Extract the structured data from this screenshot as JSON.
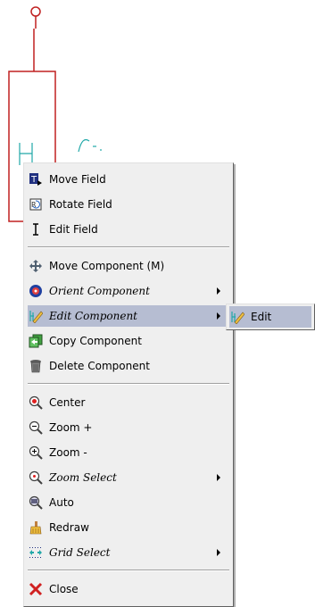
{
  "colors": {
    "schematic_red": "#c02020",
    "schematic_cyan": "#20a8a8",
    "menu_bg": "#efefef",
    "highlight": "#b6bdd2"
  },
  "menu": {
    "items": [
      {
        "label": "Move Field",
        "icon": "move-field-icon",
        "italic": false,
        "submenu": false
      },
      {
        "label": "Rotate Field",
        "icon": "rotate-field-icon",
        "italic": false,
        "submenu": false
      },
      {
        "label": "Edit Field",
        "icon": "text-cursor-icon",
        "italic": false,
        "submenu": false
      },
      {
        "label": "Move Component  (M)",
        "icon": "move-arrows-icon",
        "italic": false,
        "submenu": false
      },
      {
        "label": "Orient Component",
        "icon": "orient-icon",
        "italic": true,
        "submenu": true
      },
      {
        "label": "Edit Component",
        "icon": "edit-pencil-icon",
        "italic": true,
        "submenu": true,
        "active": true
      },
      {
        "label": "Copy Component",
        "icon": "copy-icon",
        "italic": false,
        "submenu": false
      },
      {
        "label": "Delete Component",
        "icon": "trash-icon",
        "italic": false,
        "submenu": false
      },
      {
        "label": "Center",
        "icon": "center-zoom-icon",
        "italic": false,
        "submenu": false
      },
      {
        "label": "Zoom +",
        "icon": "zoom-in-icon",
        "italic": false,
        "submenu": false
      },
      {
        "label": "Zoom -",
        "icon": "zoom-out-icon",
        "italic": false,
        "submenu": false
      },
      {
        "label": "Zoom Select",
        "icon": "zoom-select-icon",
        "italic": true,
        "submenu": true
      },
      {
        "label": "Auto",
        "icon": "zoom-auto-icon",
        "italic": false,
        "submenu": false
      },
      {
        "label": "Redraw",
        "icon": "redraw-brush-icon",
        "italic": false,
        "submenu": false
      },
      {
        "label": "Grid Select",
        "icon": "grid-icon",
        "italic": true,
        "submenu": true
      },
      {
        "label": "Close",
        "icon": "close-x-icon",
        "italic": false,
        "submenu": false
      }
    ]
  },
  "submenu": {
    "label": "Edit",
    "icon": "edit-pencil-icon"
  }
}
